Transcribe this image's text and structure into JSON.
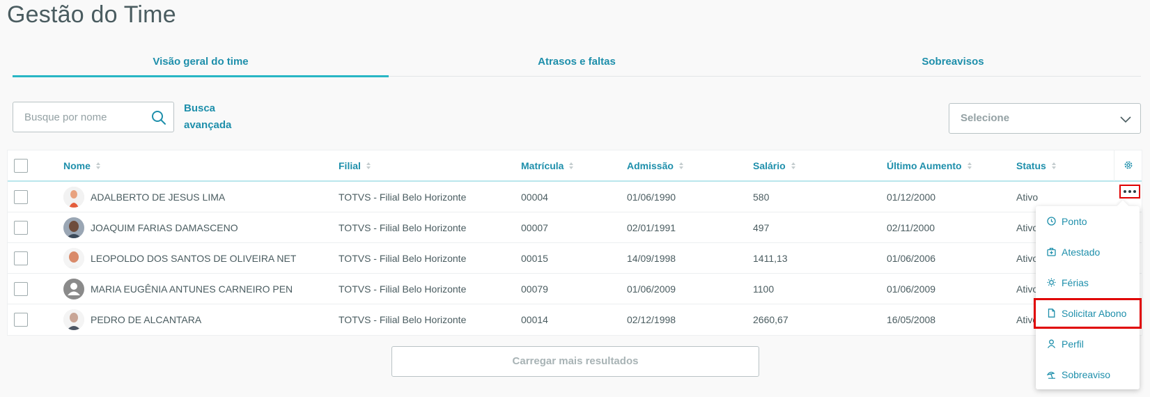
{
  "page": {
    "title": "Gestão do Time"
  },
  "tabs": [
    {
      "label": "Visão geral do time",
      "active": true
    },
    {
      "label": "Atrasos e faltas",
      "active": false
    },
    {
      "label": "Sobreavisos",
      "active": false
    }
  ],
  "search": {
    "placeholder": "Busque por nome",
    "value": ""
  },
  "advanced_search": {
    "line1": "Busca",
    "line2": "avançada"
  },
  "filter_select": {
    "value": "Selecione"
  },
  "table": {
    "columns": {
      "nome": "Nome",
      "filial": "Filial",
      "matricula": "Matrícula",
      "admissao": "Admissão",
      "salario": "Salário",
      "ultimo_aumento": "Último Aumento",
      "status": "Status"
    },
    "rows": [
      {
        "nome": "ADALBERTO DE JESUS LIMA",
        "filial": "TOTVS - Filial Belo Horizonte",
        "matricula": "00004",
        "admissao": "01/06/1990",
        "salario": "580",
        "ultimo_aumento": "01/12/2000",
        "status": "Ativo"
      },
      {
        "nome": "JOAQUIM FARIAS DAMASCENO",
        "filial": "TOTVS - Filial Belo Horizonte",
        "matricula": "00007",
        "admissao": "02/01/1991",
        "salario": "497",
        "ultimo_aumento": "02/11/2000",
        "status": "Ativo"
      },
      {
        "nome": "LEOPOLDO DOS SANTOS DE OLIVEIRA NET",
        "filial": "TOTVS - Filial Belo Horizonte",
        "matricula": "00015",
        "admissao": "14/09/1998",
        "salario": "1411,13",
        "ultimo_aumento": "01/06/2006",
        "status": "Ativo"
      },
      {
        "nome": "MARIA EUGÊNIA ANTUNES CARNEIRO PEN",
        "filial": "TOTVS - Filial Belo Horizonte",
        "matricula": "00079",
        "admissao": "01/06/2009",
        "salario": "1100",
        "ultimo_aumento": "01/06/2009",
        "status": "Ativo"
      },
      {
        "nome": "PEDRO DE ALCANTARA",
        "filial": "TOTVS - Filial Belo Horizonte",
        "matricula": "00014",
        "admissao": "02/12/1998",
        "salario": "2660,67",
        "ultimo_aumento": "16/05/2008",
        "status": "Ativo"
      }
    ]
  },
  "load_more": {
    "label": "Carregar mais resultados"
  },
  "action_menu": {
    "items": [
      {
        "label": "Ponto",
        "icon": "clock-icon"
      },
      {
        "label": "Atestado",
        "icon": "medical-kit-icon"
      },
      {
        "label": "Férias",
        "icon": "sun-icon"
      },
      {
        "label": "Solicitar Abono",
        "icon": "document-icon"
      },
      {
        "label": "Perfil",
        "icon": "user-icon"
      },
      {
        "label": "Sobreaviso",
        "icon": "beach-icon"
      }
    ]
  },
  "colors": {
    "accent": "#1e8fab",
    "tab_underline": "#29b6c5",
    "highlight": "#e00000"
  }
}
